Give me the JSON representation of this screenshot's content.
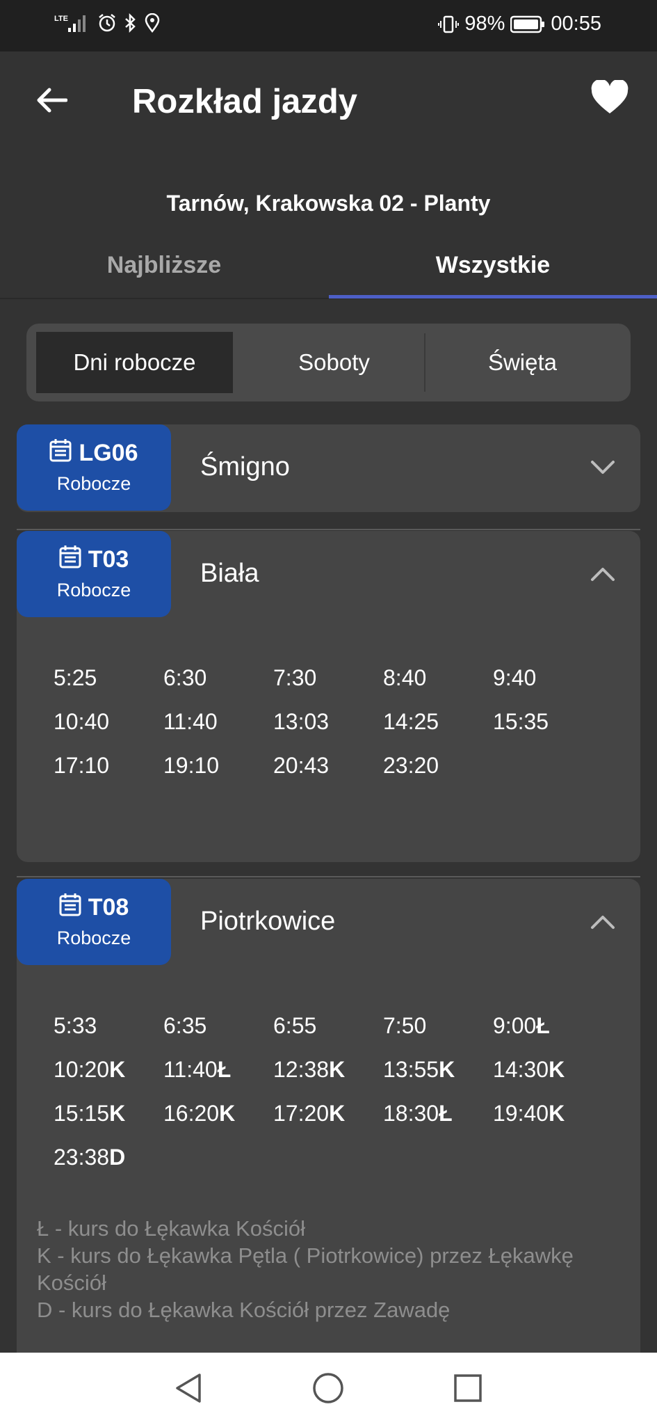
{
  "status_bar": {
    "network": "LTE",
    "battery": "98%",
    "time": "00:55"
  },
  "header": {
    "title": "Rozkład jazdy",
    "stop_name": "Tarnów, Krakowska 02 - Planty"
  },
  "tabs": [
    {
      "label": "Najbliższe",
      "active": false
    },
    {
      "label": "Wszystkie",
      "active": true
    }
  ],
  "day_types": [
    {
      "label": "Dni robocze",
      "selected": true
    },
    {
      "label": "Soboty",
      "selected": false
    },
    {
      "label": "Święta",
      "selected": false
    }
  ],
  "routes": [
    {
      "line": "LG06",
      "day_label": "Robocze",
      "destination": "Śmigno",
      "expanded": false,
      "times": []
    },
    {
      "line": "T03",
      "day_label": "Robocze",
      "destination": "Biała",
      "expanded": true,
      "times": [
        {
          "time": "5:25",
          "mark": ""
        },
        {
          "time": "6:30",
          "mark": ""
        },
        {
          "time": "7:30",
          "mark": ""
        },
        {
          "time": "8:40",
          "mark": ""
        },
        {
          "time": "9:40",
          "mark": ""
        },
        {
          "time": "10:40",
          "mark": ""
        },
        {
          "time": "11:40",
          "mark": ""
        },
        {
          "time": "13:03",
          "mark": ""
        },
        {
          "time": "14:25",
          "mark": ""
        },
        {
          "time": "15:35",
          "mark": ""
        },
        {
          "time": "17:10",
          "mark": ""
        },
        {
          "time": "19:10",
          "mark": ""
        },
        {
          "time": "20:43",
          "mark": ""
        },
        {
          "time": "23:20",
          "mark": ""
        }
      ]
    },
    {
      "line": "T08",
      "day_label": "Robocze",
      "destination": "Piotrkowice",
      "expanded": true,
      "times": [
        {
          "time": "5:33",
          "mark": ""
        },
        {
          "time": "6:35",
          "mark": ""
        },
        {
          "time": "6:55",
          "mark": ""
        },
        {
          "time": "7:50",
          "mark": ""
        },
        {
          "time": "9:00",
          "mark": "Ł"
        },
        {
          "time": "10:20",
          "mark": "K"
        },
        {
          "time": "11:40",
          "mark": "Ł"
        },
        {
          "time": "12:38",
          "mark": "K"
        },
        {
          "time": "13:55",
          "mark": "K"
        },
        {
          "time": "14:30",
          "mark": "K"
        },
        {
          "time": "15:15",
          "mark": "K"
        },
        {
          "time": "16:20",
          "mark": "K"
        },
        {
          "time": "17:20",
          "mark": "K"
        },
        {
          "time": "18:30",
          "mark": "Ł"
        },
        {
          "time": "19:40",
          "mark": "K"
        },
        {
          "time": "23:38",
          "mark": "D"
        }
      ],
      "legend": [
        "Ł - kurs do Łękawka Kościół",
        "K - kurs do Łękawka Pętla ( Piotrkowice) przez Łękawkę Kościół",
        "D - kurs do Łękawka Kościół przez Zawadę"
      ]
    }
  ],
  "colors": {
    "background": "#333333",
    "card": "#454545",
    "badge": "#1e4fa6",
    "tab_indicator": "#4d5fc7"
  }
}
